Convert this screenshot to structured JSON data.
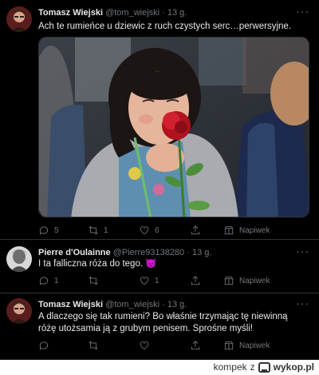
{
  "tweets": [
    {
      "name": "Tomasz Wiejski",
      "handle": "@tom_wiejski",
      "separator": "·",
      "time": "13 g.",
      "text": "Ach te rumieńce u dziewic z ruch czystych serc…perwersyjne.",
      "counts": {
        "replies": "5",
        "retweets": "1",
        "likes": "6"
      },
      "tip_label": "Napiwek"
    },
    {
      "name": "Pierre d'Oulainne",
      "handle": "@Pierre93138280",
      "separator": "·",
      "time": "13 g.",
      "text": "I ta falliczna róża do tego. 😈",
      "counts": {
        "replies": "1",
        "retweets": "",
        "likes": "1"
      },
      "tip_label": "Napiwek"
    },
    {
      "name": "Tomasz Wiejski",
      "handle": "@tom_wiejski",
      "separator": "·",
      "time": "13 g.",
      "text": "A dlaczego się tak rumieni? Bo właśnie trzymając tę niewinną różę utożsamia ją z grubym penisem. Sprośne myśli!",
      "counts": {
        "replies": "",
        "retweets": "",
        "likes": ""
      },
      "tip_label": "Napiwek"
    }
  ],
  "more_label": "···",
  "footer": {
    "user": "kompek",
    "z": "z",
    "site": "wykop.pl"
  },
  "colors": {
    "background": "#000000",
    "text": "#e7e9ea",
    "secondary": "#71767b",
    "rose": "#b0121f"
  }
}
